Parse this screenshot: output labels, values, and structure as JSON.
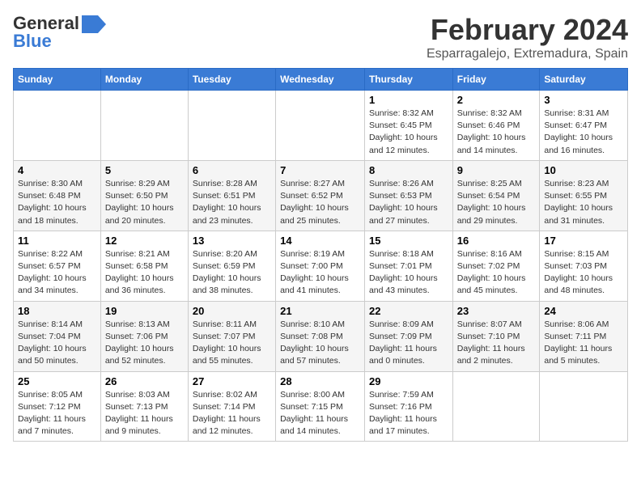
{
  "logo": {
    "general": "General",
    "blue": "Blue"
  },
  "title": "February 2024",
  "subtitle": "Esparragalejo, Extremadura, Spain",
  "headers": [
    "Sunday",
    "Monday",
    "Tuesday",
    "Wednesday",
    "Thursday",
    "Friday",
    "Saturday"
  ],
  "weeks": [
    [
      {
        "day": "",
        "content": ""
      },
      {
        "day": "",
        "content": ""
      },
      {
        "day": "",
        "content": ""
      },
      {
        "day": "",
        "content": ""
      },
      {
        "day": "1",
        "content": "Sunrise: 8:32 AM\nSunset: 6:45 PM\nDaylight: 10 hours\nand 12 minutes."
      },
      {
        "day": "2",
        "content": "Sunrise: 8:32 AM\nSunset: 6:46 PM\nDaylight: 10 hours\nand 14 minutes."
      },
      {
        "day": "3",
        "content": "Sunrise: 8:31 AM\nSunset: 6:47 PM\nDaylight: 10 hours\nand 16 minutes."
      }
    ],
    [
      {
        "day": "4",
        "content": "Sunrise: 8:30 AM\nSunset: 6:48 PM\nDaylight: 10 hours\nand 18 minutes."
      },
      {
        "day": "5",
        "content": "Sunrise: 8:29 AM\nSunset: 6:50 PM\nDaylight: 10 hours\nand 20 minutes."
      },
      {
        "day": "6",
        "content": "Sunrise: 8:28 AM\nSunset: 6:51 PM\nDaylight: 10 hours\nand 23 minutes."
      },
      {
        "day": "7",
        "content": "Sunrise: 8:27 AM\nSunset: 6:52 PM\nDaylight: 10 hours\nand 25 minutes."
      },
      {
        "day": "8",
        "content": "Sunrise: 8:26 AM\nSunset: 6:53 PM\nDaylight: 10 hours\nand 27 minutes."
      },
      {
        "day": "9",
        "content": "Sunrise: 8:25 AM\nSunset: 6:54 PM\nDaylight: 10 hours\nand 29 minutes."
      },
      {
        "day": "10",
        "content": "Sunrise: 8:23 AM\nSunset: 6:55 PM\nDaylight: 10 hours\nand 31 minutes."
      }
    ],
    [
      {
        "day": "11",
        "content": "Sunrise: 8:22 AM\nSunset: 6:57 PM\nDaylight: 10 hours\nand 34 minutes."
      },
      {
        "day": "12",
        "content": "Sunrise: 8:21 AM\nSunset: 6:58 PM\nDaylight: 10 hours\nand 36 minutes."
      },
      {
        "day": "13",
        "content": "Sunrise: 8:20 AM\nSunset: 6:59 PM\nDaylight: 10 hours\nand 38 minutes."
      },
      {
        "day": "14",
        "content": "Sunrise: 8:19 AM\nSunset: 7:00 PM\nDaylight: 10 hours\nand 41 minutes."
      },
      {
        "day": "15",
        "content": "Sunrise: 8:18 AM\nSunset: 7:01 PM\nDaylight: 10 hours\nand 43 minutes."
      },
      {
        "day": "16",
        "content": "Sunrise: 8:16 AM\nSunset: 7:02 PM\nDaylight: 10 hours\nand 45 minutes."
      },
      {
        "day": "17",
        "content": "Sunrise: 8:15 AM\nSunset: 7:03 PM\nDaylight: 10 hours\nand 48 minutes."
      }
    ],
    [
      {
        "day": "18",
        "content": "Sunrise: 8:14 AM\nSunset: 7:04 PM\nDaylight: 10 hours\nand 50 minutes."
      },
      {
        "day": "19",
        "content": "Sunrise: 8:13 AM\nSunset: 7:06 PM\nDaylight: 10 hours\nand 52 minutes."
      },
      {
        "day": "20",
        "content": "Sunrise: 8:11 AM\nSunset: 7:07 PM\nDaylight: 10 hours\nand 55 minutes."
      },
      {
        "day": "21",
        "content": "Sunrise: 8:10 AM\nSunset: 7:08 PM\nDaylight: 10 hours\nand 57 minutes."
      },
      {
        "day": "22",
        "content": "Sunrise: 8:09 AM\nSunset: 7:09 PM\nDaylight: 11 hours\nand 0 minutes."
      },
      {
        "day": "23",
        "content": "Sunrise: 8:07 AM\nSunset: 7:10 PM\nDaylight: 11 hours\nand 2 minutes."
      },
      {
        "day": "24",
        "content": "Sunrise: 8:06 AM\nSunset: 7:11 PM\nDaylight: 11 hours\nand 5 minutes."
      }
    ],
    [
      {
        "day": "25",
        "content": "Sunrise: 8:05 AM\nSunset: 7:12 PM\nDaylight: 11 hours\nand 7 minutes."
      },
      {
        "day": "26",
        "content": "Sunrise: 8:03 AM\nSunset: 7:13 PM\nDaylight: 11 hours\nand 9 minutes."
      },
      {
        "day": "27",
        "content": "Sunrise: 8:02 AM\nSunset: 7:14 PM\nDaylight: 11 hours\nand 12 minutes."
      },
      {
        "day": "28",
        "content": "Sunrise: 8:00 AM\nSunset: 7:15 PM\nDaylight: 11 hours\nand 14 minutes."
      },
      {
        "day": "29",
        "content": "Sunrise: 7:59 AM\nSunset: 7:16 PM\nDaylight: 11 hours\nand 17 minutes."
      },
      {
        "day": "",
        "content": ""
      },
      {
        "day": "",
        "content": ""
      }
    ]
  ]
}
